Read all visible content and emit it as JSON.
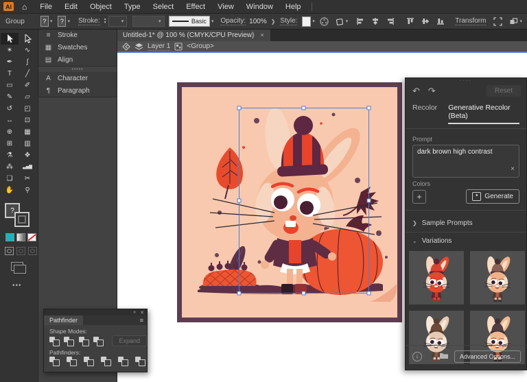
{
  "menu_bar": {
    "logo": "Ai",
    "home_icon": "⌂",
    "items": [
      "File",
      "Edit",
      "Object",
      "Type",
      "Select",
      "Effect",
      "View",
      "Window",
      "Help"
    ]
  },
  "control_bar": {
    "context_label": "Group",
    "fill_unknown": "?",
    "stroke_unknown": "?",
    "stroke_label": "Stroke:",
    "brush_label": "Basic",
    "opacity_label": "Opacity:",
    "opacity_value": "100%",
    "style_label": "Style:",
    "transform_label": "Transform"
  },
  "document_tab": {
    "title": "Untitled-1* @ 100 % (CMYK/CPU Preview)",
    "close": "×"
  },
  "breadcrumb": {
    "layer": "Layer 1",
    "group": "<Group>"
  },
  "left_dock": {
    "groups": [
      [
        {
          "label": "Stroke",
          "glyph": "≡"
        },
        {
          "label": "Swatches",
          "glyph": "▦"
        },
        {
          "label": "Align",
          "glyph": "▤"
        }
      ],
      [
        {
          "label": "Character",
          "glyph": "A"
        },
        {
          "label": "Paragraph",
          "glyph": "¶"
        }
      ]
    ]
  },
  "tools": [
    {
      "name": "selection-tool",
      "glyph": "arrow-filled",
      "active": true
    },
    {
      "name": "direct-selection-tool",
      "glyph": "arrow-outline",
      "active": false
    },
    {
      "name": "magic-wand-tool",
      "glyph": "✶"
    },
    {
      "name": "lasso-tool",
      "glyph": "∿"
    },
    {
      "name": "pen-tool",
      "glyph": "✒"
    },
    {
      "name": "curvature-tool",
      "glyph": "ʃ"
    },
    {
      "name": "type-tool",
      "glyph": "T"
    },
    {
      "name": "line-segment-tool",
      "glyph": "╱"
    },
    {
      "name": "rectangle-tool",
      "glyph": "▭"
    },
    {
      "name": "paintbrush-tool",
      "glyph": "✐"
    },
    {
      "name": "pencil-tool",
      "glyph": "✎"
    },
    {
      "name": "eraser-tool",
      "glyph": "▱"
    },
    {
      "name": "rotate-tool",
      "glyph": "↺"
    },
    {
      "name": "scale-tool",
      "glyph": "◰"
    },
    {
      "name": "width-tool",
      "glyph": "↔"
    },
    {
      "name": "free-transform-tool",
      "glyph": "⊡"
    },
    {
      "name": "shape-builder-tool",
      "glyph": "⊕"
    },
    {
      "name": "perspective-grid-tool",
      "glyph": "▦"
    },
    {
      "name": "mesh-tool",
      "glyph": "⊞"
    },
    {
      "name": "gradient-tool",
      "glyph": "▥"
    },
    {
      "name": "eyedropper-tool",
      "glyph": "⚗"
    },
    {
      "name": "blend-tool",
      "glyph": "❖"
    },
    {
      "name": "symbol-sprayer-tool",
      "glyph": "⁂"
    },
    {
      "name": "column-graph-tool",
      "glyph": "▃▅▇"
    },
    {
      "name": "artboard-tool",
      "glyph": "❏"
    },
    {
      "name": "slice-tool",
      "glyph": "✂"
    },
    {
      "name": "hand-tool",
      "glyph": "✋"
    },
    {
      "name": "zoom-tool",
      "glyph": "⚲"
    }
  ],
  "right_panel": {
    "reset_label": "Reset",
    "tabs": [
      {
        "label": "Recolor",
        "active": false
      },
      {
        "label": "Generative Recolor (Beta)",
        "active": true
      }
    ],
    "prompt_label": "Prompt",
    "prompt_value": "dark brown high contrast",
    "prompt_clear": "×",
    "colors_label": "Colors",
    "add_color": "+",
    "generate_label": "Generate",
    "sample_prompts_label": "Sample Prompts",
    "variations_label": "Variations",
    "advanced_options_label": "Advanced Options...",
    "variations": [
      {
        "name": "variation-1",
        "palette": {
          "body": "#e2492e",
          "light": "#f6d6c0",
          "hat": "#d84330",
          "band": "#612336",
          "pom": "#612336",
          "outfit": "#612336",
          "accent": "#c03a24",
          "boot": "#a82e1f"
        }
      },
      {
        "name": "variation-2",
        "palette": {
          "body": "#eeb189",
          "light": "#f8ddc2",
          "hat": "#8a6156",
          "band": "#4e3339",
          "pom": "#453037",
          "outfit": "#4e3a37",
          "accent": "#b5593c",
          "boot": "#3c2e32"
        }
      },
      {
        "name": "variation-3",
        "palette": {
          "body": "#e6cab4",
          "light": "#f6e9da",
          "hat": "#6d4937",
          "band": "#54392a",
          "pom": "#5c3f2f",
          "outfit": "#564138",
          "accent": "#8a5a42",
          "boot": "#6d4937"
        }
      },
      {
        "name": "variation-4",
        "palette": {
          "body": "#f0b98f",
          "light": "#f9ddc1",
          "hat": "#4f3e44",
          "band": "#382b31",
          "pom": "#42333a",
          "outfit": "#3f3138",
          "accent": "#c0552f",
          "boot": "#32282e"
        }
      }
    ]
  },
  "pathfinder": {
    "title": "Pathfinder",
    "shape_modes_label": "Shape Modes:",
    "expand_label": "Expand",
    "pathfinders_label": "Pathfinders:",
    "shape_modes": [
      "unite",
      "minus-front",
      "intersect",
      "exclude"
    ],
    "pathfinders": [
      "divide",
      "trim",
      "merge",
      "crop",
      "outline",
      "minus-back"
    ]
  },
  "artwork": {
    "palette": {
      "background": "#f8c9ae",
      "border": "#5d3e50",
      "rabbit_body": "#f3b391",
      "rabbit_light": "#f6d6c0",
      "hat_red": "#e8432b",
      "hat_purple": "#5e2742",
      "jacket": "#5e2d44",
      "pumpkin": "#ee5532",
      "leaf_red": "#e84b2c",
      "leaf_purple": "#5c2333",
      "ground": "#5d3048",
      "selection_blue": "#4b7fd6"
    }
  }
}
